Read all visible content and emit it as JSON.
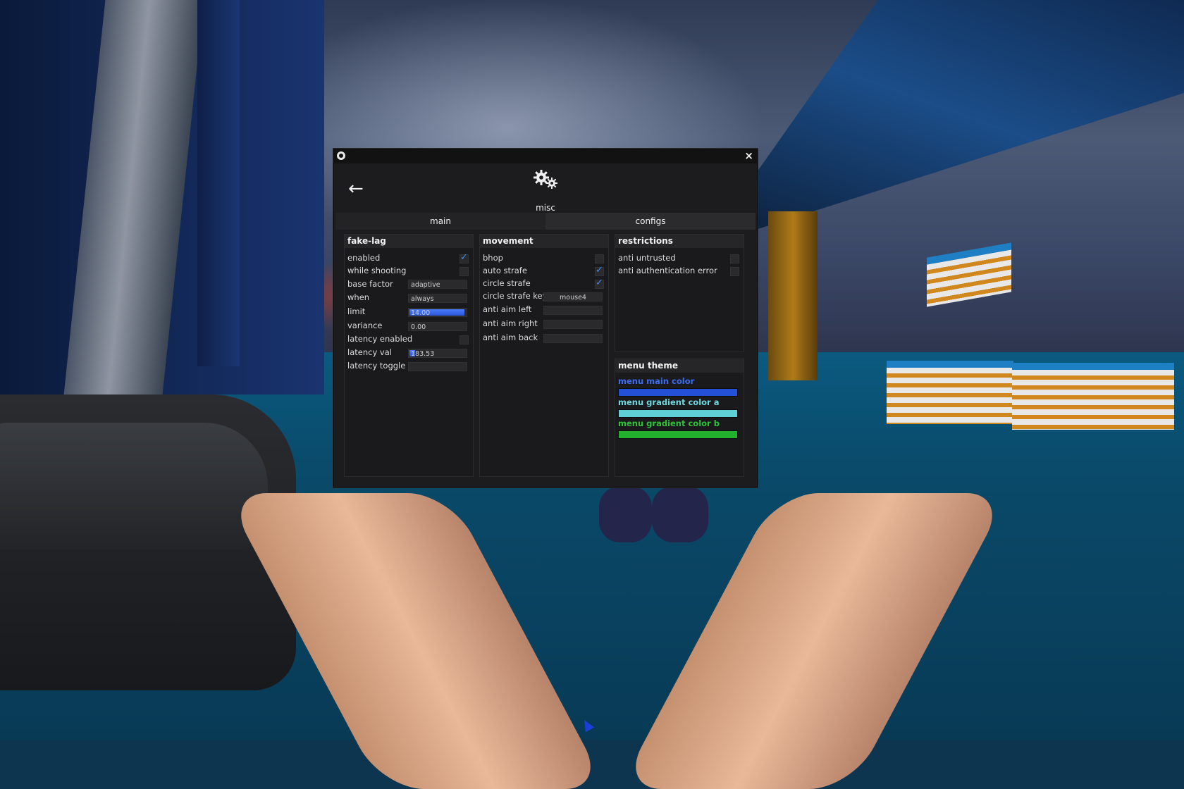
{
  "window": {
    "section_title": "misc",
    "close_glyph": "×",
    "back_glyph": "←",
    "tabs": [
      {
        "label": "main",
        "active": true
      },
      {
        "label": "configs",
        "active": false
      }
    ]
  },
  "fake_lag": {
    "title": "fake-lag",
    "enabled": {
      "label": "enabled",
      "checked": true
    },
    "while_shooting": {
      "label": "while shooting",
      "checked": false
    },
    "base_factor": {
      "label": "base factor",
      "value": "adaptive"
    },
    "when": {
      "label": "when",
      "value": "always"
    },
    "limit": {
      "label": "limit",
      "value": "14.00",
      "fill_fraction": 0.97
    },
    "variance": {
      "label": "variance",
      "value": "0.00",
      "fill_fraction": 0.0
    },
    "latency_enabled": {
      "label": "latency enabled",
      "checked": false
    },
    "latency_val": {
      "label": "latency val",
      "value": "183.53",
      "fill_fraction": 0.1
    },
    "latency_toggle": {
      "label": "latency toggle",
      "value": ""
    }
  },
  "movement": {
    "title": "movement",
    "bhop": {
      "label": "bhop",
      "checked": false
    },
    "auto_strafe": {
      "label": "auto strafe",
      "checked": true
    },
    "circle_strafe": {
      "label": "circle strafe",
      "checked": true
    },
    "circle_strafe_key": {
      "label": "circle strafe key",
      "value": "mouse4"
    },
    "anti_aim_left": {
      "label": "anti aim left",
      "value": ""
    },
    "anti_aim_right": {
      "label": "anti aim right",
      "value": ""
    },
    "anti_aim_back": {
      "label": "anti aim back",
      "value": ""
    }
  },
  "restrictions": {
    "title": "restrictions",
    "anti_untrusted": {
      "label": "anti untrusted",
      "checked": false
    },
    "anti_authentication_error": {
      "label": "anti authentication error",
      "checked": false
    }
  },
  "menu_theme": {
    "title": "menu theme",
    "main_color": {
      "label": "menu main color",
      "color": "#2450d8"
    },
    "gradient_a": {
      "label": "menu gradient color a",
      "color": "#5fd0d6"
    },
    "gradient_b": {
      "label": "menu gradient color b",
      "color": "#22b02e"
    }
  },
  "colors": {
    "accent_divider": "#3ecf8a",
    "checkbox_check": "#3a8bff",
    "slider_fill": "#3a66f0"
  }
}
